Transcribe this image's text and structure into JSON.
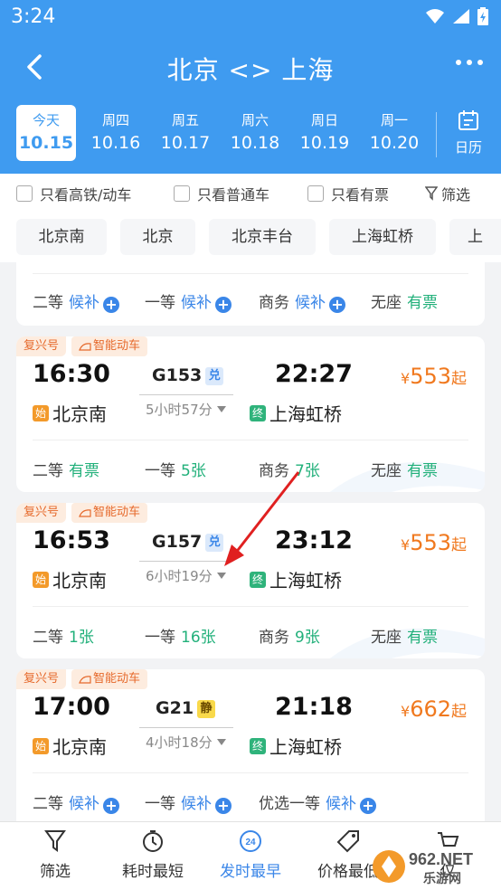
{
  "status_bar": {
    "time": "3:24"
  },
  "header": {
    "title": "北京 <> 上海"
  },
  "dates": [
    {
      "weekday": "今天",
      "date": "10.15",
      "active": true
    },
    {
      "weekday": "周四",
      "date": "10.16"
    },
    {
      "weekday": "周五",
      "date": "10.17"
    },
    {
      "weekday": "周六",
      "date": "10.18"
    },
    {
      "weekday": "周日",
      "date": "10.19"
    },
    {
      "weekday": "周一",
      "date": "10.20"
    }
  ],
  "calendar_label": "日历",
  "filters": {
    "high_speed": "只看高铁/动车",
    "normal": "只看普通车",
    "available": "只看有票",
    "screen": "筛选"
  },
  "stations": [
    "北京南",
    "北京",
    "北京丰台",
    "上海虹桥",
    "上"
  ],
  "partial_card": {
    "seats": [
      {
        "class": "二等",
        "status": "候补"
      },
      {
        "class": "一等",
        "status": "候补"
      },
      {
        "class": "商务",
        "status": "候补"
      },
      {
        "class": "无座",
        "status": "有票"
      }
    ]
  },
  "trains": [
    {
      "badge1": "复兴号",
      "badge2": "智能动车",
      "depart": "16:30",
      "arrive": "22:27",
      "number": "G153",
      "tag": "兑",
      "duration": "5小时57分",
      "from_mark": "始",
      "from": "北京南",
      "to_mark": "终",
      "to": "上海虹桥",
      "price_currency": "¥",
      "price": "553",
      "price_suffix": "起",
      "seats": [
        {
          "class": "二等",
          "status": "有票"
        },
        {
          "class": "一等",
          "status": "5张"
        },
        {
          "class": "商务",
          "status": "7张"
        },
        {
          "class": "无座",
          "status": "有票"
        }
      ]
    },
    {
      "badge1": "复兴号",
      "badge2": "智能动车",
      "depart": "16:53",
      "arrive": "23:12",
      "number": "G157",
      "tag": "兑",
      "duration": "6小时19分",
      "from_mark": "始",
      "from": "北京南",
      "to_mark": "终",
      "to": "上海虹桥",
      "price_currency": "¥",
      "price": "553",
      "price_suffix": "起",
      "seats": [
        {
          "class": "二等",
          "status": "1张"
        },
        {
          "class": "一等",
          "status": "16张"
        },
        {
          "class": "商务",
          "status": "9张"
        },
        {
          "class": "无座",
          "status": "有票"
        }
      ]
    },
    {
      "badge1": "复兴号",
      "badge2": "智能动车",
      "depart": "17:00",
      "arrive": "21:18",
      "number": "G21",
      "tag": "静",
      "duration": "4小时18分",
      "from_mark": "始",
      "from": "北京南",
      "to_mark": "终",
      "to": "上海虹桥",
      "price_currency": "¥",
      "price": "662",
      "price_suffix": "起",
      "seats": [
        {
          "class": "二等",
          "status": "候补"
        },
        {
          "class": "一等",
          "status": "候补"
        },
        {
          "class": "优选一等",
          "status": "候补"
        }
      ]
    }
  ],
  "tabs": [
    {
      "label": "筛选",
      "icon": "filter-icon"
    },
    {
      "label": "耗时最短",
      "icon": "timer-icon"
    },
    {
      "label": "发时最早",
      "icon": "clock-24-icon",
      "active": true,
      "icon_text": "24"
    },
    {
      "label": "价格最低",
      "icon": "price-tag-icon"
    },
    {
      "label": "仅",
      "icon": "cart-icon"
    }
  ],
  "watermark": "962.NET 乐游网",
  "colors": {
    "primary": "#3f9bf0",
    "accent_orange": "#f0791f",
    "green": "#21b07a",
    "link_blue": "#3a86e8"
  }
}
